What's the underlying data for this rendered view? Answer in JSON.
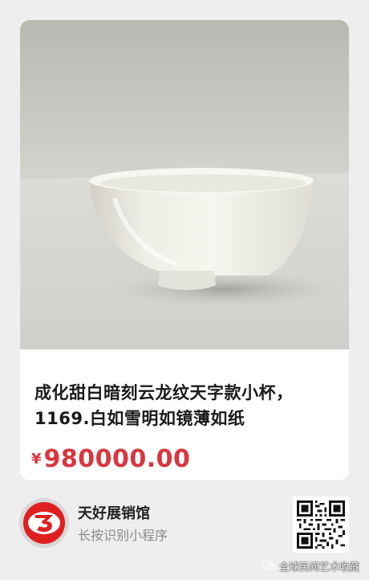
{
  "product": {
    "photo_alt": "white porcelain cup",
    "title": "成化甜白暗刻云龙纹天字款小杯，1169.白如雪明如镜薄如纸",
    "currency_symbol": "¥",
    "price": "980000.00"
  },
  "store": {
    "logo_icon": "red-3-logo-icon",
    "name": "天好展销馆",
    "hint": "长按识别小程序"
  },
  "qr": {
    "icon": "qr-code-icon"
  },
  "watermark": {
    "icon": "wechat-icon",
    "text": "全球民间艺术收藏"
  },
  "colors": {
    "price": "#d9363e",
    "logo_red": "#e02020",
    "page_background": "#eeeeee"
  }
}
